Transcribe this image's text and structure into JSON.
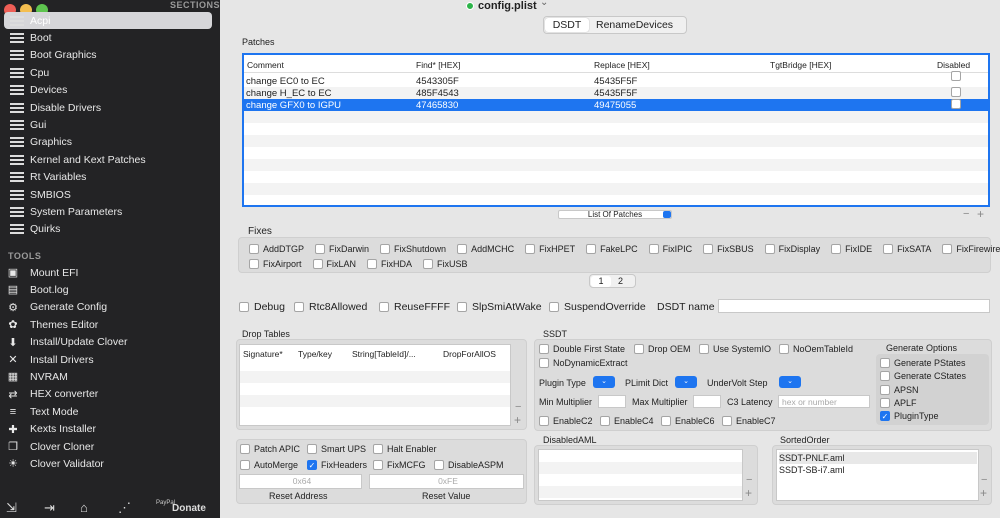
{
  "sidebar": {
    "sections_header": "SECTIONS",
    "items": [
      {
        "label": "Acpi"
      },
      {
        "label": "Boot"
      },
      {
        "label": "Boot Graphics"
      },
      {
        "label": "Cpu"
      },
      {
        "label": "Devices"
      },
      {
        "label": "Disable Drivers"
      },
      {
        "label": "Gui"
      },
      {
        "label": "Graphics"
      },
      {
        "label": "Kernel and Kext Patches"
      },
      {
        "label": "Rt Variables"
      },
      {
        "label": "SMBIOS"
      },
      {
        "label": "System Parameters"
      },
      {
        "label": "Quirks"
      }
    ],
    "tools_header": "TOOLS",
    "tools": [
      {
        "label": "Mount EFI",
        "icon": "drive-icon",
        "glyph": "▣"
      },
      {
        "label": "Boot.log",
        "icon": "document-icon",
        "glyph": "▤"
      },
      {
        "label": "Generate Config",
        "icon": "gear-icon",
        "glyph": "⚙"
      },
      {
        "label": "Themes Editor",
        "icon": "palette-icon",
        "glyph": "✿"
      },
      {
        "label": "Install/Update Clover",
        "icon": "download-icon",
        "glyph": "⬇"
      },
      {
        "label": "Install Drivers",
        "icon": "wrench-icon",
        "glyph": "✕"
      },
      {
        "label": "NVRAM",
        "icon": "chip-icon",
        "glyph": "▦"
      },
      {
        "label": "HEX converter",
        "icon": "convert-icon",
        "glyph": "⇄"
      },
      {
        "label": "Text Mode",
        "icon": "text-icon",
        "glyph": "≡"
      },
      {
        "label": "Kexts Installer",
        "icon": "puzzle-icon",
        "glyph": "✚"
      },
      {
        "label": "Clover Cloner",
        "icon": "copy-icon",
        "glyph": "❐"
      },
      {
        "label": "Clover Validator",
        "icon": "bulb-icon",
        "glyph": "☀"
      }
    ],
    "donate_label": "Donate",
    "paypal_label": "PayPal"
  },
  "title": {
    "file": "config.plist",
    "chevron": "⌄"
  },
  "tabs": {
    "dsdt": "DSDT",
    "rename": "RenameDevices"
  },
  "patches": {
    "label": "Patches",
    "columns": [
      "Comment",
      "Find* [HEX]",
      "Replace [HEX]",
      "TgtBridge [HEX]",
      "Disabled"
    ],
    "rows": [
      {
        "comment": "change EC0 to EC",
        "find": "4543305F",
        "replace": "45435F5F",
        "tgt": ""
      },
      {
        "comment": "change H_EC to EC",
        "find": "485F4543",
        "replace": "45435F5F",
        "tgt": ""
      },
      {
        "comment": "change GFX0 to IGPU",
        "find": "47465830",
        "replace": "49475055",
        "tgt": ""
      }
    ],
    "list_popup": "List Of Patches"
  },
  "fixes": {
    "label": "Fixes",
    "row1": [
      "AddDTGP",
      "FixDarwin",
      "FixShutdown",
      "AddMCHC",
      "FixHPET",
      "FakeLPC",
      "FixIPIC",
      "FixSBUS",
      "FixDisplay",
      "FixIDE",
      "FixSATA",
      "FixFirewire"
    ],
    "row2": [
      "FixAirport",
      "FixLAN",
      "FixHDA",
      "FixUSB"
    ],
    "page1": "1",
    "page2": "2"
  },
  "options": {
    "debug": "Debug",
    "rtc": "Rtc8Allowed",
    "reuse": "ReuseFFFF",
    "slp": "SlpSmiAtWake",
    "suspend": "SuspendOverride",
    "dsdt_name": "DSDT name"
  },
  "drop_tables": {
    "label": "Drop Tables",
    "columns": [
      "Signature*",
      "Type/key",
      "String[TableId]/...",
      "DropForAllOS"
    ]
  },
  "ssdt": {
    "label": "SSDT",
    "checks": [
      "Double First State",
      "Drop OEM",
      "Use SystemIO",
      "NoOemTableId",
      "NoDynamicExtract"
    ],
    "plugin_type": "Plugin Type",
    "plimit": "PLimit Dict",
    "undervolt": "UnderVolt Step",
    "min_mult": "Min Multiplier",
    "max_mult": "Max Multiplier",
    "c3": "C3 Latency",
    "c3_placeholder": "hex or number",
    "cstates": [
      "EnableC2",
      "EnableC4",
      "EnableC6",
      "EnableC7"
    ]
  },
  "gen_options": {
    "label": "Generate Options",
    "items": [
      {
        "label": "Generate PStates",
        "on": false
      },
      {
        "label": "Generate CStates",
        "on": false
      },
      {
        "label": "APSN",
        "on": false
      },
      {
        "label": "APLF",
        "on": false
      },
      {
        "label": "PluginType",
        "on": true
      }
    ]
  },
  "bottom": {
    "patch_apic": "Patch APIC",
    "smart_ups": "Smart UPS",
    "halt": "Halt Enabler",
    "automerge": "AutoMerge",
    "fixheaders": "FixHeaders",
    "fixmcfg": "FixMCFG",
    "disableaspm": "DisableASPM",
    "reset_addr_ph": "0x64",
    "reset_val_ph": "0xFE",
    "reset_addr": "Reset Address",
    "reset_val": "Reset Value"
  },
  "disabled_aml": {
    "label": "DisabledAML"
  },
  "sorted_order": {
    "label": "SortedOrder",
    "items": [
      "SSDT-PNLF.aml",
      "SSDT-SB-i7.aml"
    ]
  },
  "colors": {
    "accent": "#1e75f0",
    "sidebar": "#232325"
  }
}
